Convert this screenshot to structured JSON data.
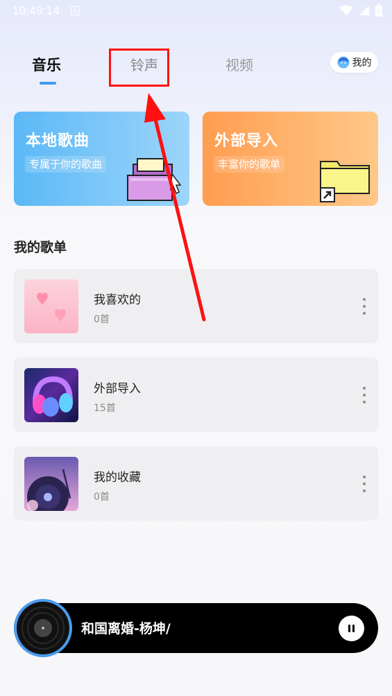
{
  "status_bar": {
    "time": "10:49:14",
    "notification_letter": "A",
    "icons": [
      "wifi-icon",
      "signal-icon",
      "battery-icon"
    ]
  },
  "tabs": [
    {
      "label": "音乐",
      "active": true
    },
    {
      "label": "铃声",
      "active": false
    },
    {
      "label": "视频",
      "active": false
    }
  ],
  "me_button": {
    "label": "我的",
    "icon": "avatar-icon"
  },
  "cards": {
    "local": {
      "title": "本地歌曲",
      "subtitle": "专属于你的歌曲",
      "icon": "folder-open-icon"
    },
    "import": {
      "title": "外部导入",
      "subtitle": "丰富你的歌单",
      "icon": "folder-shortcut-icon"
    }
  },
  "section": {
    "title": "我的歌单"
  },
  "playlists": [
    {
      "name": "我喜欢的",
      "count": "0首",
      "cover": "hearts-cover"
    },
    {
      "name": "外部导入",
      "count": "15首",
      "cover": "headphones-cover"
    },
    {
      "name": "我的收藏",
      "count": "0首",
      "cover": "vinyl-cover"
    }
  ],
  "player": {
    "song": "和国离婚-杨坤/",
    "icon": "vinyl-disc-icon",
    "control": "pause-icon"
  },
  "colors": {
    "accent": "#3e9bf4",
    "highlight": "#ff1010",
    "local_card": "#5bb8f6",
    "import_card": "#ff9d50"
  }
}
